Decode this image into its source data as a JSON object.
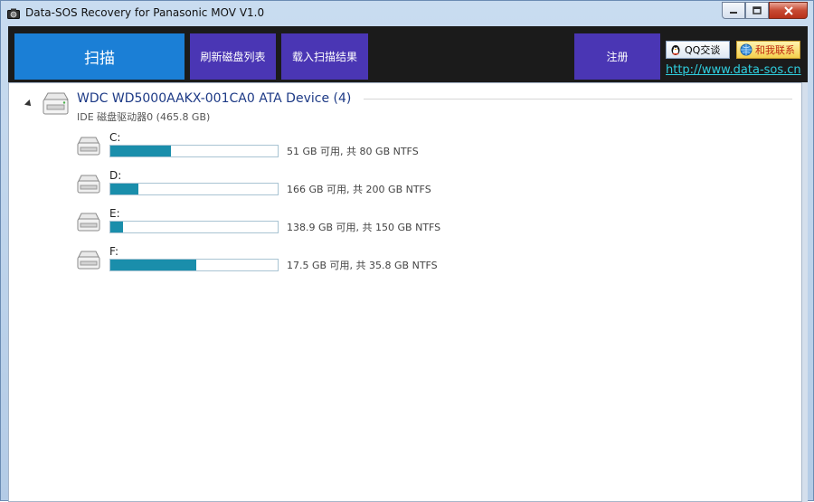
{
  "window": {
    "title": "Data-SOS Recovery for Panasonic MOV V1.0"
  },
  "toolbar": {
    "scan_label": "扫描",
    "refresh_label": "刷新磁盘列表",
    "load_label": "载入扫描结果",
    "register_label": "注册",
    "qq_label": "QQ交谈",
    "contact_label": "和我联系",
    "website": "http://www.data-sos.cn"
  },
  "device": {
    "name": "WDC WD5000AAKX-001CA0 ATA Device (4)",
    "subtitle": "IDE 磁盘驱动器0 (465.8 GB)",
    "volumes": [
      {
        "letter": "C:",
        "info": "51 GB 可用, 共 80 GB NTFS",
        "used_fraction": 0.3625
      },
      {
        "letter": "D:",
        "info": "166 GB 可用, 共 200 GB NTFS",
        "used_fraction": 0.17
      },
      {
        "letter": "E:",
        "info": "138.9 GB 可用, 共 150 GB NTFS",
        "used_fraction": 0.074
      },
      {
        "letter": "F:",
        "info": "17.5 GB 可用, 共 35.8 GB NTFS",
        "used_fraction": 0.511
      }
    ]
  },
  "colors": {
    "scan_button": "#1b7fd6",
    "toolbar_button": "#4a36b4",
    "toolbar_bg": "#1b1b1b",
    "usage_fill": "#1a8eab",
    "link": "#2fcfdf"
  },
  "icons": {
    "app": "camera-icon",
    "device": "hard-drive-icon",
    "volume": "drive-icon",
    "qq": "qq-penguin-icon",
    "contact": "globe-icon"
  }
}
